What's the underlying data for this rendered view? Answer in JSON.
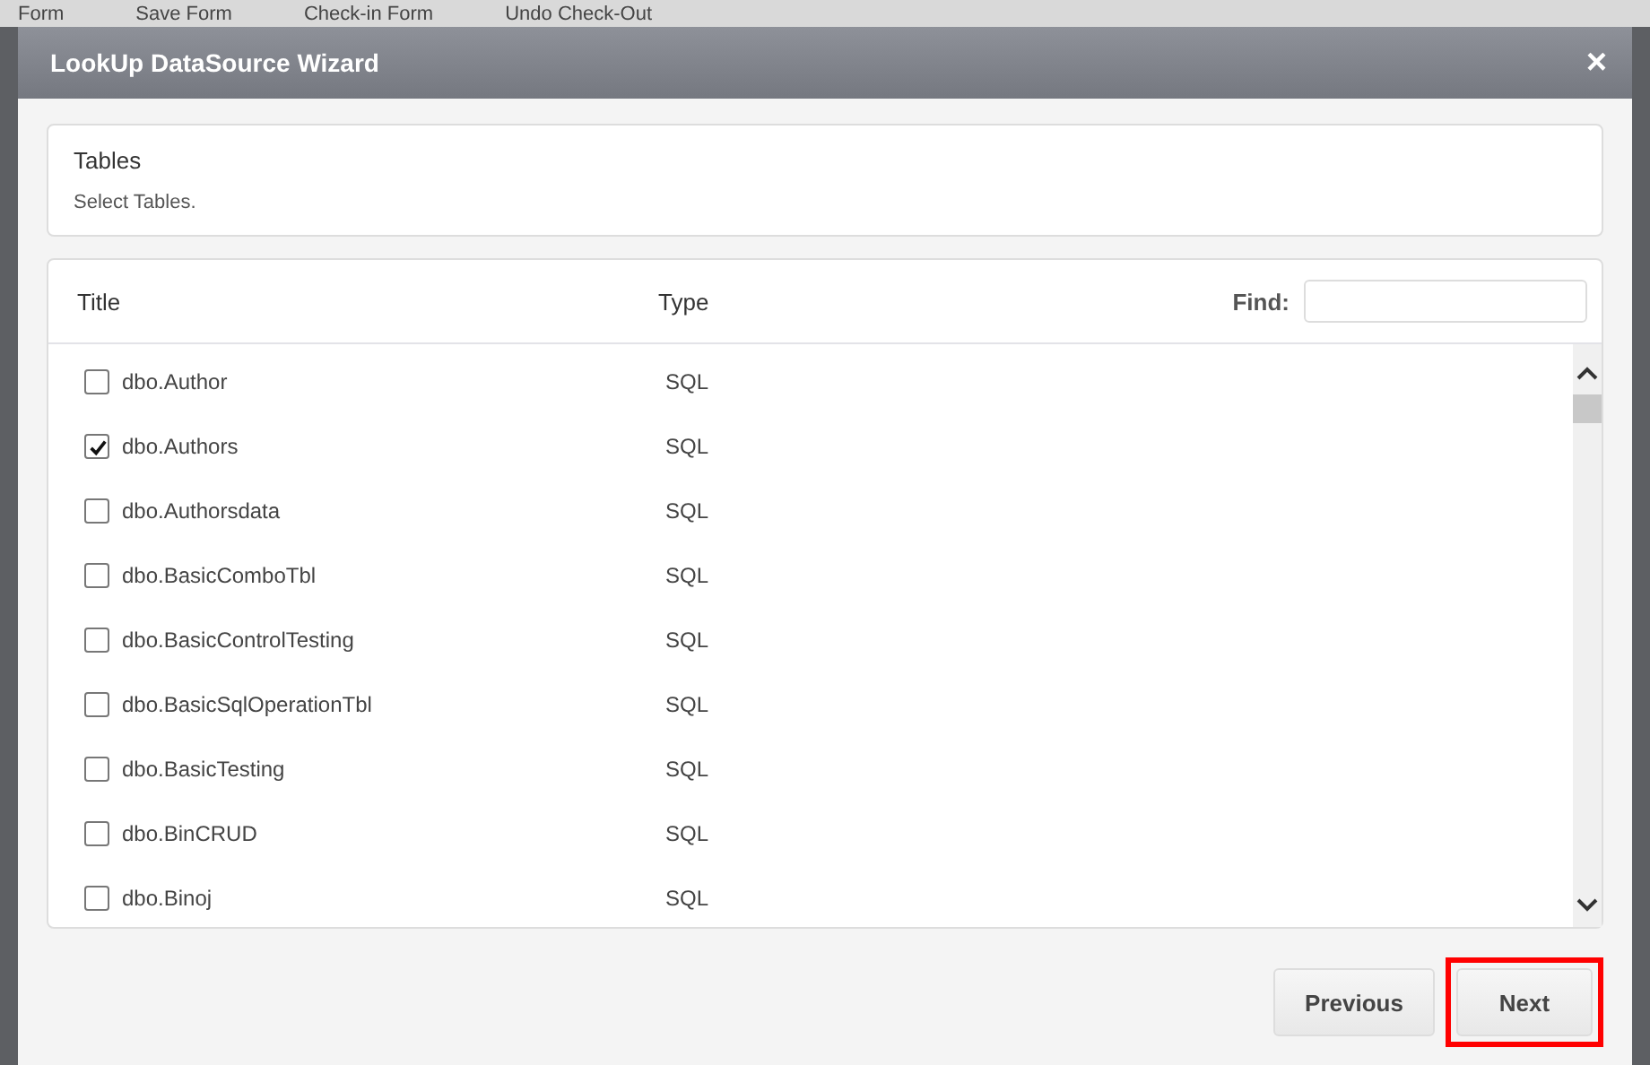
{
  "background_toolbar": {
    "items": [
      "Form",
      "Save Form",
      "Check-in Form",
      "Undo Check-Out"
    ]
  },
  "window": {
    "title": "LookUp DataSource Wizard",
    "close": "×"
  },
  "step": {
    "title": "Tables",
    "description": "Select Tables."
  },
  "table": {
    "columns": [
      "Title",
      "Type"
    ],
    "find": {
      "label": "Find:"
    },
    "rows": [
      {
        "title": "dbo.Author",
        "type": "SQL",
        "checked": false
      },
      {
        "title": "dbo.Authors",
        "type": "SQL",
        "checked": true
      },
      {
        "title": "dbo.Authorsdata",
        "type": "SQL",
        "checked": false
      },
      {
        "title": "dbo.BasicComboTbl",
        "type": "SQL",
        "checked": false
      },
      {
        "title": "dbo.BasicControlTesting",
        "type": "SQL",
        "checked": false
      },
      {
        "title": "dbo.BasicSqlOperationTbl",
        "type": "SQL",
        "checked": false
      },
      {
        "title": "dbo.BasicTesting",
        "type": "SQL",
        "checked": false
      },
      {
        "title": "dbo.BinCRUD",
        "type": "SQL",
        "checked": false
      },
      {
        "title": "dbo.Binoj",
        "type": "SQL",
        "checked": false
      }
    ]
  },
  "buttons": [
    {
      "label": "Previous",
      "highlighted": false
    },
    {
      "label": "Next",
      "highlighted": true
    }
  ]
}
